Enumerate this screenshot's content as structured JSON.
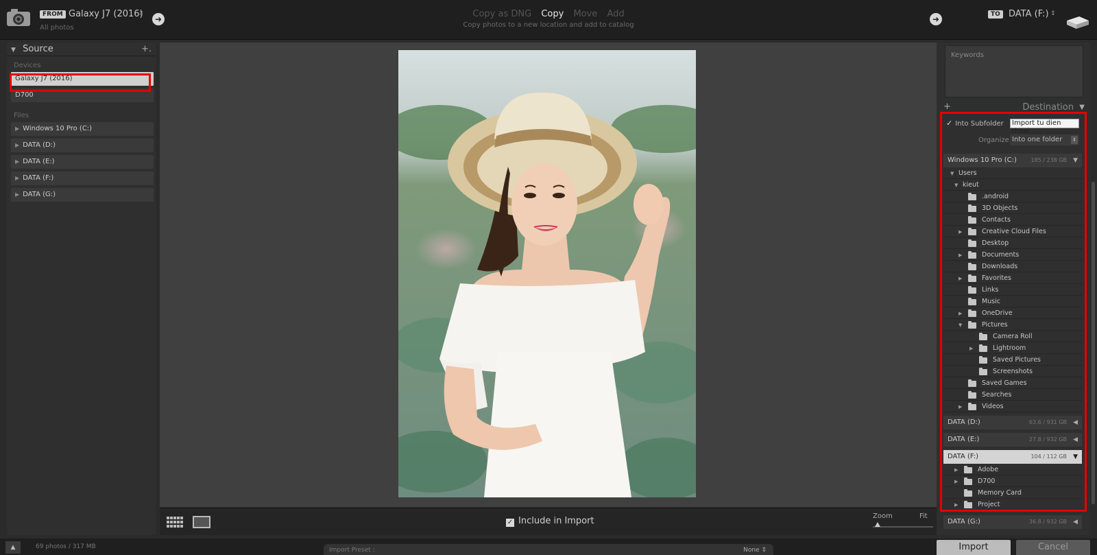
{
  "header": {
    "from_badge": "FROM",
    "from_device": "Galaxy J7 (2016)",
    "from_sub": "All photos",
    "updown": "⇕",
    "arrow": "➜",
    "modes": [
      "Copy as DNG",
      "Copy",
      "Move",
      "Add"
    ],
    "active_mode": "Copy",
    "mode_description": "Copy photos to a new location and add to catalog",
    "to_badge": "TO",
    "to_drive": "DATA (F:)"
  },
  "source": {
    "title": "Source",
    "plus": "+.",
    "devices_label": "Devices",
    "devices": [
      "Galaxy J7 (2016)",
      "D700"
    ],
    "files_label": "Files",
    "files": [
      "Windows 10 Pro (C:)",
      "DATA (D:)",
      "DATA (E:)",
      "DATA (F:)",
      "DATA (G:)"
    ]
  },
  "toolbar": {
    "include_label": "Include in Import",
    "zoom_label": "Zoom",
    "fit_label": "Fit"
  },
  "right": {
    "keywords_label": "Keywords",
    "destination_title": "Destination",
    "plus": "+",
    "into_subfolder_label": "Into Subfolder",
    "subfolder_value": "Import tu dien thoai",
    "organize_label": "Organize",
    "organize_value": "Into one folder",
    "drives": [
      {
        "name": "Windows 10 Pro (C:)",
        "size": "185 / 238 GB"
      },
      {
        "name": "DATA (D:)",
        "size": "63.6 / 931 GB"
      },
      {
        "name": "DATA (E:)",
        "size": "27.8 / 932 GB"
      },
      {
        "name": "DATA (F:)",
        "size": "104 / 112 GB"
      },
      {
        "name": "DATA (G:)",
        "size": "36.8 / 932 GB"
      }
    ],
    "c_tree": [
      {
        "name": "Users"
      },
      {
        "name": "kieut"
      },
      {
        "name": ".android"
      },
      {
        "name": "3D Objects"
      },
      {
        "name": "Contacts"
      },
      {
        "name": "Creative Cloud Files"
      },
      {
        "name": "Desktop"
      },
      {
        "name": "Documents"
      },
      {
        "name": "Downloads"
      },
      {
        "name": "Favorites"
      },
      {
        "name": "Links"
      },
      {
        "name": "Music"
      },
      {
        "name": "OneDrive"
      },
      {
        "name": "Pictures"
      },
      {
        "name": "Camera Roll"
      },
      {
        "name": "Lightroom"
      },
      {
        "name": "Saved Pictures"
      },
      {
        "name": "Screenshots"
      },
      {
        "name": "Saved Games"
      },
      {
        "name": "Searches"
      },
      {
        "name": "Videos"
      }
    ],
    "f_tree": [
      {
        "name": "Adobe"
      },
      {
        "name": "D700"
      },
      {
        "name": "Memory Card"
      },
      {
        "name": "Project"
      }
    ]
  },
  "footer": {
    "collapse": "▲",
    "photo_count": "69 photos / 317 MB",
    "preset_label": "Import Preset :",
    "preset_value": "None ⇕",
    "import_label": "Import",
    "cancel_label": "Cancel"
  },
  "colors": {
    "highlight_box": "#e60000",
    "panel_bg": "#2f2f2f",
    "center_bg": "#404040"
  }
}
